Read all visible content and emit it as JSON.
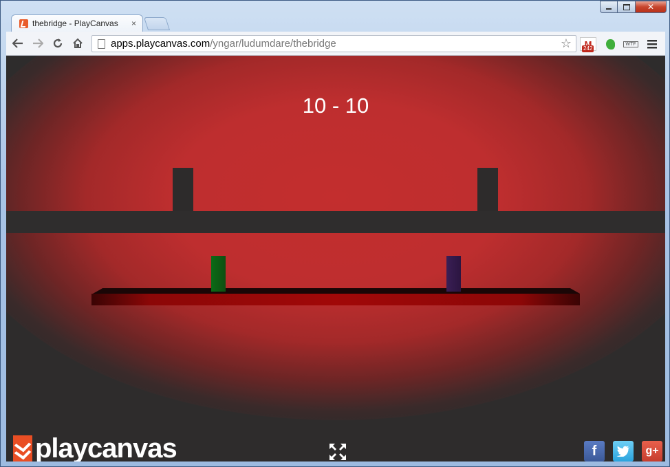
{
  "browser": {
    "tab": {
      "title": "thebridge - PlayCanvas",
      "close": "×"
    },
    "url": {
      "host": "apps.playcanvas.com",
      "path": "/yngar/ludumdare/thebridge"
    },
    "gmail_count": "242",
    "gmail_letter": "M",
    "wtf_label": "WTF"
  },
  "game": {
    "score": "10 - 10",
    "logo_text": "playcanvas",
    "share": {
      "facebook": "f",
      "google_plus": "g+"
    }
  },
  "colors": {
    "glow": "#c32e2e",
    "background": "#2e2c2c",
    "platform": "#a10808",
    "player_green": "#0b6b16",
    "player_purple": "#3a1e55",
    "logo_orange": "#e94e24"
  }
}
